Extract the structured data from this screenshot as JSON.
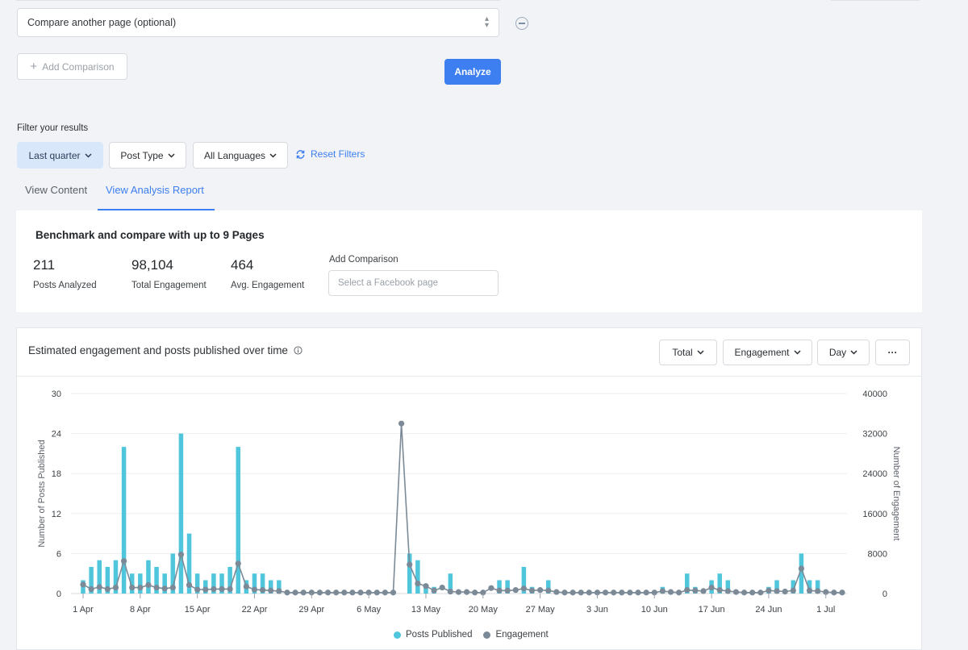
{
  "compare": {
    "select_value": "Compare another page (optional)",
    "add_comparison_label": "Add Comparison",
    "analyze_label": "Analyze"
  },
  "filters": {
    "label": "Filter your results",
    "period": "Last quarter",
    "post_type": "Post Type",
    "languages": "All Languages",
    "reset": "Reset Filters"
  },
  "tabs": [
    {
      "label": "View Content",
      "active": false
    },
    {
      "label": "View Analysis Report",
      "active": true
    }
  ],
  "benchmark": {
    "title": "Benchmark and compare with up to 9 Pages",
    "stats": [
      {
        "value": "211",
        "label": "Posts Analyzed"
      },
      {
        "value": "98,104",
        "label": "Total Engagement"
      },
      {
        "value": "464",
        "label": "Avg. Engagement"
      }
    ],
    "add_comparison_label": "Add Comparison",
    "fb_placeholder": "Select a Facebook page"
  },
  "chart_panel": {
    "title": "Estimated engagement and posts published over time",
    "controls": {
      "total": "Total",
      "metric": "Engagement",
      "granularity": "Day",
      "more": "···"
    }
  },
  "colors": {
    "accent": "#3d7ff0",
    "posts_bar": "#4fc6dc",
    "engagement_line": "#7b8a96"
  },
  "chart_data": {
    "type": "bar",
    "title": "Estimated engagement and posts published over time",
    "ylabel_left": "Number of Posts Published",
    "ylabel_right": "Number of Engagement",
    "yticks_left": [
      "0",
      "6",
      "12",
      "18",
      "24",
      "30"
    ],
    "yticks_right": [
      "0",
      "8000",
      "16000",
      "24000",
      "32000",
      "40000"
    ],
    "ylim_left": [
      0,
      30
    ],
    "ylim_right": [
      0,
      40000
    ],
    "x_tick_labels": [
      "1 Apr",
      "8 Apr",
      "15 Apr",
      "22 Apr",
      "29 Apr",
      "6 May",
      "13 May",
      "20 May",
      "27 May",
      "3 Jun",
      "10 Jun",
      "17 Jun",
      "24 Jun",
      "1 Jul"
    ],
    "x_start": "1 Apr",
    "legend_position": "bottom",
    "series": [
      {
        "name": "Posts Published",
        "type": "bar",
        "axis": "left",
        "values": [
          2,
          4,
          5,
          4,
          5,
          22,
          3,
          3,
          5,
          4,
          3,
          6,
          24,
          9,
          3,
          2,
          3,
          3,
          4,
          22,
          2,
          3,
          3,
          2,
          2,
          0,
          0,
          0,
          0,
          0,
          0,
          0,
          0,
          0,
          0,
          0,
          0,
          0,
          0,
          0,
          6,
          5,
          1,
          1,
          0,
          3,
          0,
          0,
          0,
          0,
          0,
          2,
          2,
          0,
          4,
          1,
          0,
          2,
          0,
          0,
          0,
          0,
          0,
          0,
          0,
          0,
          0,
          0,
          0,
          0,
          0,
          1,
          0,
          0,
          3,
          1,
          0,
          2,
          3,
          2,
          0,
          0,
          0,
          0,
          1,
          2,
          0,
          2,
          6,
          2,
          2,
          0,
          0,
          0
        ]
      },
      {
        "name": "Engagement",
        "type": "line",
        "axis": "right",
        "values": [
          1800,
          900,
          1300,
          900,
          1200,
          6500,
          1200,
          1200,
          1700,
          1200,
          1000,
          1200,
          7800,
          1700,
          800,
          800,
          900,
          900,
          900,
          6000,
          1400,
          800,
          700,
          600,
          500,
          200,
          200,
          200,
          200,
          200,
          200,
          200,
          200,
          200,
          200,
          200,
          200,
          200,
          200,
          34000,
          5800,
          2000,
          1500,
          600,
          1200,
          400,
          300,
          300,
          200,
          200,
          1100,
          600,
          600,
          700,
          1000,
          600,
          700,
          600,
          300,
          200,
          200,
          200,
          200,
          200,
          200,
          200,
          200,
          200,
          200,
          200,
          200,
          500,
          300,
          200,
          700,
          600,
          500,
          1200,
          700,
          500,
          300,
          200,
          200,
          200,
          600,
          500,
          400,
          600,
          5000,
          600,
          500,
          300,
          200,
          200
        ]
      }
    ]
  }
}
